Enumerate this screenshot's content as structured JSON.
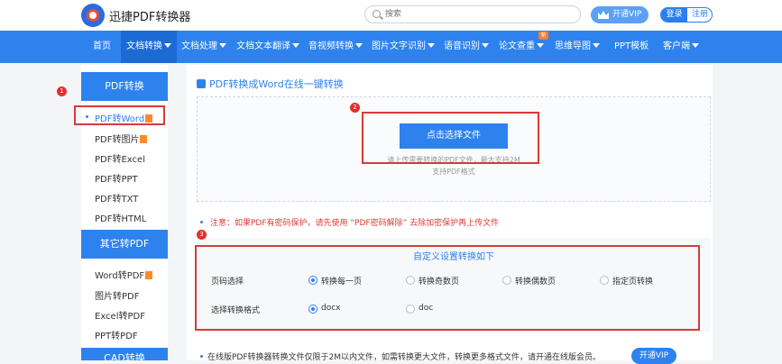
{
  "header": {
    "brand": "迅捷PDF转换器",
    "search_placeholder": "搜索",
    "vip_label": "开通VIP",
    "login_label": "登录",
    "register_label": "注册"
  },
  "nav": {
    "items": [
      {
        "label": "首页",
        "caret": false
      },
      {
        "label": "文档转换",
        "caret": true
      },
      {
        "label": "文档处理",
        "caret": true
      },
      {
        "label": "文档文本翻译",
        "caret": true
      },
      {
        "label": "音视频转换",
        "caret": true
      },
      {
        "label": "图片文字识别",
        "caret": true
      },
      {
        "label": "语音识别",
        "caret": true
      },
      {
        "label": "论文查重",
        "caret": true
      },
      {
        "label": "思维导图",
        "caret": true
      },
      {
        "label": "PPT模板",
        "caret": false
      },
      {
        "label": "客户端",
        "caret": true
      }
    ],
    "new_badge": "新"
  },
  "annotations": [
    "1",
    "2",
    "3"
  ],
  "sidebar": {
    "group1_title": "PDF转换",
    "group1_items": [
      "PDF转Word",
      "PDF转图片",
      "PDF转Excel",
      "PDF转PPT",
      "PDF转TXT",
      "PDF转HTML"
    ],
    "group2_title": "其它转PDF",
    "group2_items": [
      "Word转PDF",
      "图片转PDF",
      "Excel转PDF",
      "PPT转PDF"
    ],
    "group3_title": "CAD转换"
  },
  "main": {
    "title": "PDF转换成Word在线一键转换",
    "choose_button": "点击选择文件",
    "upload_hint1": "请上传需要转换的PDF文件，最大支持2M",
    "upload_hint2": "支持PDF格式",
    "warning": "注意：如果PDF有密码保护，请先使用 “PDF密码解除” 去除加密保护再上传文件",
    "settings_title": "自定义设置转换如下",
    "page_label": "页码选择",
    "page_options": [
      "转换每一页",
      "转换奇数页",
      "转换偶数页",
      "指定页转换"
    ],
    "page_selected": 0,
    "format_label": "选择转换格式",
    "format_options": [
      "docx",
      "doc"
    ],
    "format_selected": 0,
    "footer_note": "在线版PDF转换器转换文件仅限于2M以内文件，如需转换更大文件，转换更多格式文件，请开通在线版会员。",
    "footer_vip": "开通VIP"
  }
}
